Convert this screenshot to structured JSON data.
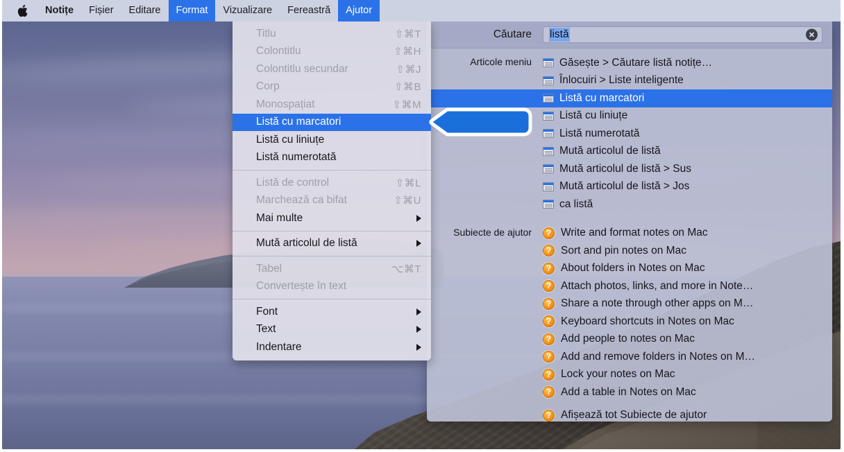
{
  "menubar": {
    "apple_icon": "apple-logo-icon",
    "items": [
      {
        "label": "Notițe",
        "app": true,
        "active": false
      },
      {
        "label": "Fișier",
        "app": false,
        "active": false
      },
      {
        "label": "Editare",
        "app": false,
        "active": false
      },
      {
        "label": "Format",
        "app": false,
        "active": true
      },
      {
        "label": "Vizualizare",
        "app": false,
        "active": false
      },
      {
        "label": "Fereastră",
        "app": false,
        "active": false
      },
      {
        "label": "Ajutor",
        "app": false,
        "active": true
      }
    ]
  },
  "format_menu": {
    "groups": [
      {
        "rows": [
          {
            "label": "Titlu",
            "shortcut": "⇧⌘T",
            "disabled": true,
            "selected": false,
            "submenu": false
          },
          {
            "label": "Colontitlu",
            "shortcut": "⇧⌘H",
            "disabled": true,
            "selected": false,
            "submenu": false
          },
          {
            "label": "Colontitlu secundar",
            "shortcut": "⇧⌘J",
            "disabled": true,
            "selected": false,
            "submenu": false
          },
          {
            "label": "Corp",
            "shortcut": "⇧⌘B",
            "disabled": true,
            "selected": false,
            "submenu": false
          },
          {
            "label": "Monospațiat",
            "shortcut": "⇧⌘M",
            "disabled": true,
            "selected": false,
            "submenu": false
          },
          {
            "label": "Listă cu marcatori",
            "shortcut": "",
            "disabled": false,
            "selected": true,
            "submenu": false
          },
          {
            "label": "Listă cu liniuțe",
            "shortcut": "",
            "disabled": false,
            "selected": false,
            "submenu": false
          },
          {
            "label": "Listă numerotată",
            "shortcut": "",
            "disabled": false,
            "selected": false,
            "submenu": false
          }
        ]
      },
      {
        "rows": [
          {
            "label": "Listă de control",
            "shortcut": "⇧⌘L",
            "disabled": true,
            "selected": false,
            "submenu": false
          },
          {
            "label": "Marchează ca bifat",
            "shortcut": "⇧⌘U",
            "disabled": true,
            "selected": false,
            "submenu": false
          },
          {
            "label": "Mai multe",
            "shortcut": "",
            "disabled": false,
            "selected": false,
            "submenu": true
          }
        ]
      },
      {
        "rows": [
          {
            "label": "Mută articolul de listă",
            "shortcut": "",
            "disabled": false,
            "selected": false,
            "submenu": true
          }
        ]
      },
      {
        "rows": [
          {
            "label": "Tabel",
            "shortcut": "⌥⌘T",
            "disabled": true,
            "selected": false,
            "submenu": false
          },
          {
            "label": "Convertește în text",
            "shortcut": "",
            "disabled": true,
            "selected": false,
            "submenu": false
          }
        ]
      },
      {
        "rows": [
          {
            "label": "Font",
            "shortcut": "",
            "disabled": false,
            "selected": false,
            "submenu": true
          },
          {
            "label": "Text",
            "shortcut": "",
            "disabled": false,
            "selected": false,
            "submenu": true
          },
          {
            "label": "Indentare",
            "shortcut": "",
            "disabled": false,
            "selected": false,
            "submenu": true
          }
        ]
      }
    ]
  },
  "help_panel": {
    "search_label": "Căutare",
    "search_value": "listă",
    "search_placeholder": "Căutare",
    "clear_icon": "clear-circle-x-icon",
    "sections": [
      {
        "label": "Articole meniu",
        "icon": "menu-item-icon",
        "rows": [
          {
            "label": "Găsește > Căutare listă notițe…",
            "selected": false
          },
          {
            "label": "Înlocuiri > Liste inteligente",
            "selected": false
          },
          {
            "label": "Listă cu marcatori",
            "selected": true
          },
          {
            "label": "Listă cu liniuțe",
            "selected": false
          },
          {
            "label": "Listă numerotată",
            "selected": false
          },
          {
            "label": "Mută articolul de listă",
            "selected": false
          },
          {
            "label": "Mută articolul de listă > Sus",
            "selected": false
          },
          {
            "label": "Mută articolul de listă > Jos",
            "selected": false
          },
          {
            "label": "ca listă",
            "selected": false
          }
        ]
      },
      {
        "label": "Subiecte de ajutor",
        "icon": "help-question-icon",
        "rows": [
          {
            "label": "Write and format notes on Mac",
            "selected": false
          },
          {
            "label": "Sort and pin notes on Mac",
            "selected": false
          },
          {
            "label": "About folders in Notes on Mac",
            "selected": false
          },
          {
            "label": "Attach photos, links, and more in Note…",
            "selected": false
          },
          {
            "label": "Share a note through other apps on M…",
            "selected": false
          },
          {
            "label": "Keyboard shortcuts in Notes on Mac",
            "selected": false
          },
          {
            "label": "Add people to notes on Mac",
            "selected": false
          },
          {
            "label": "Add and remove folders in Notes on M…",
            "selected": false
          },
          {
            "label": "Lock your notes on Mac",
            "selected": false
          },
          {
            "label": "Add a table in Notes on Mac",
            "selected": false
          }
        ],
        "footer": {
          "label": "Afișează tot Subiecte de ajutor",
          "selected": false
        }
      }
    ]
  },
  "callout": {
    "icon": "left-pointing-arrow-callout",
    "fill_color": "#1a6fdb",
    "outline_color": "#ffffff"
  },
  "colors": {
    "accent_blue": "#2b72e8",
    "menubar_bg": "#ccd2e2",
    "menu_bg": "#dedde8",
    "help_panel_bg": "#babed3",
    "help_icon_orange": "#f79a1d"
  },
  "desktop": {
    "wallpaper_name": "coastal-sunset-wallpaper"
  }
}
